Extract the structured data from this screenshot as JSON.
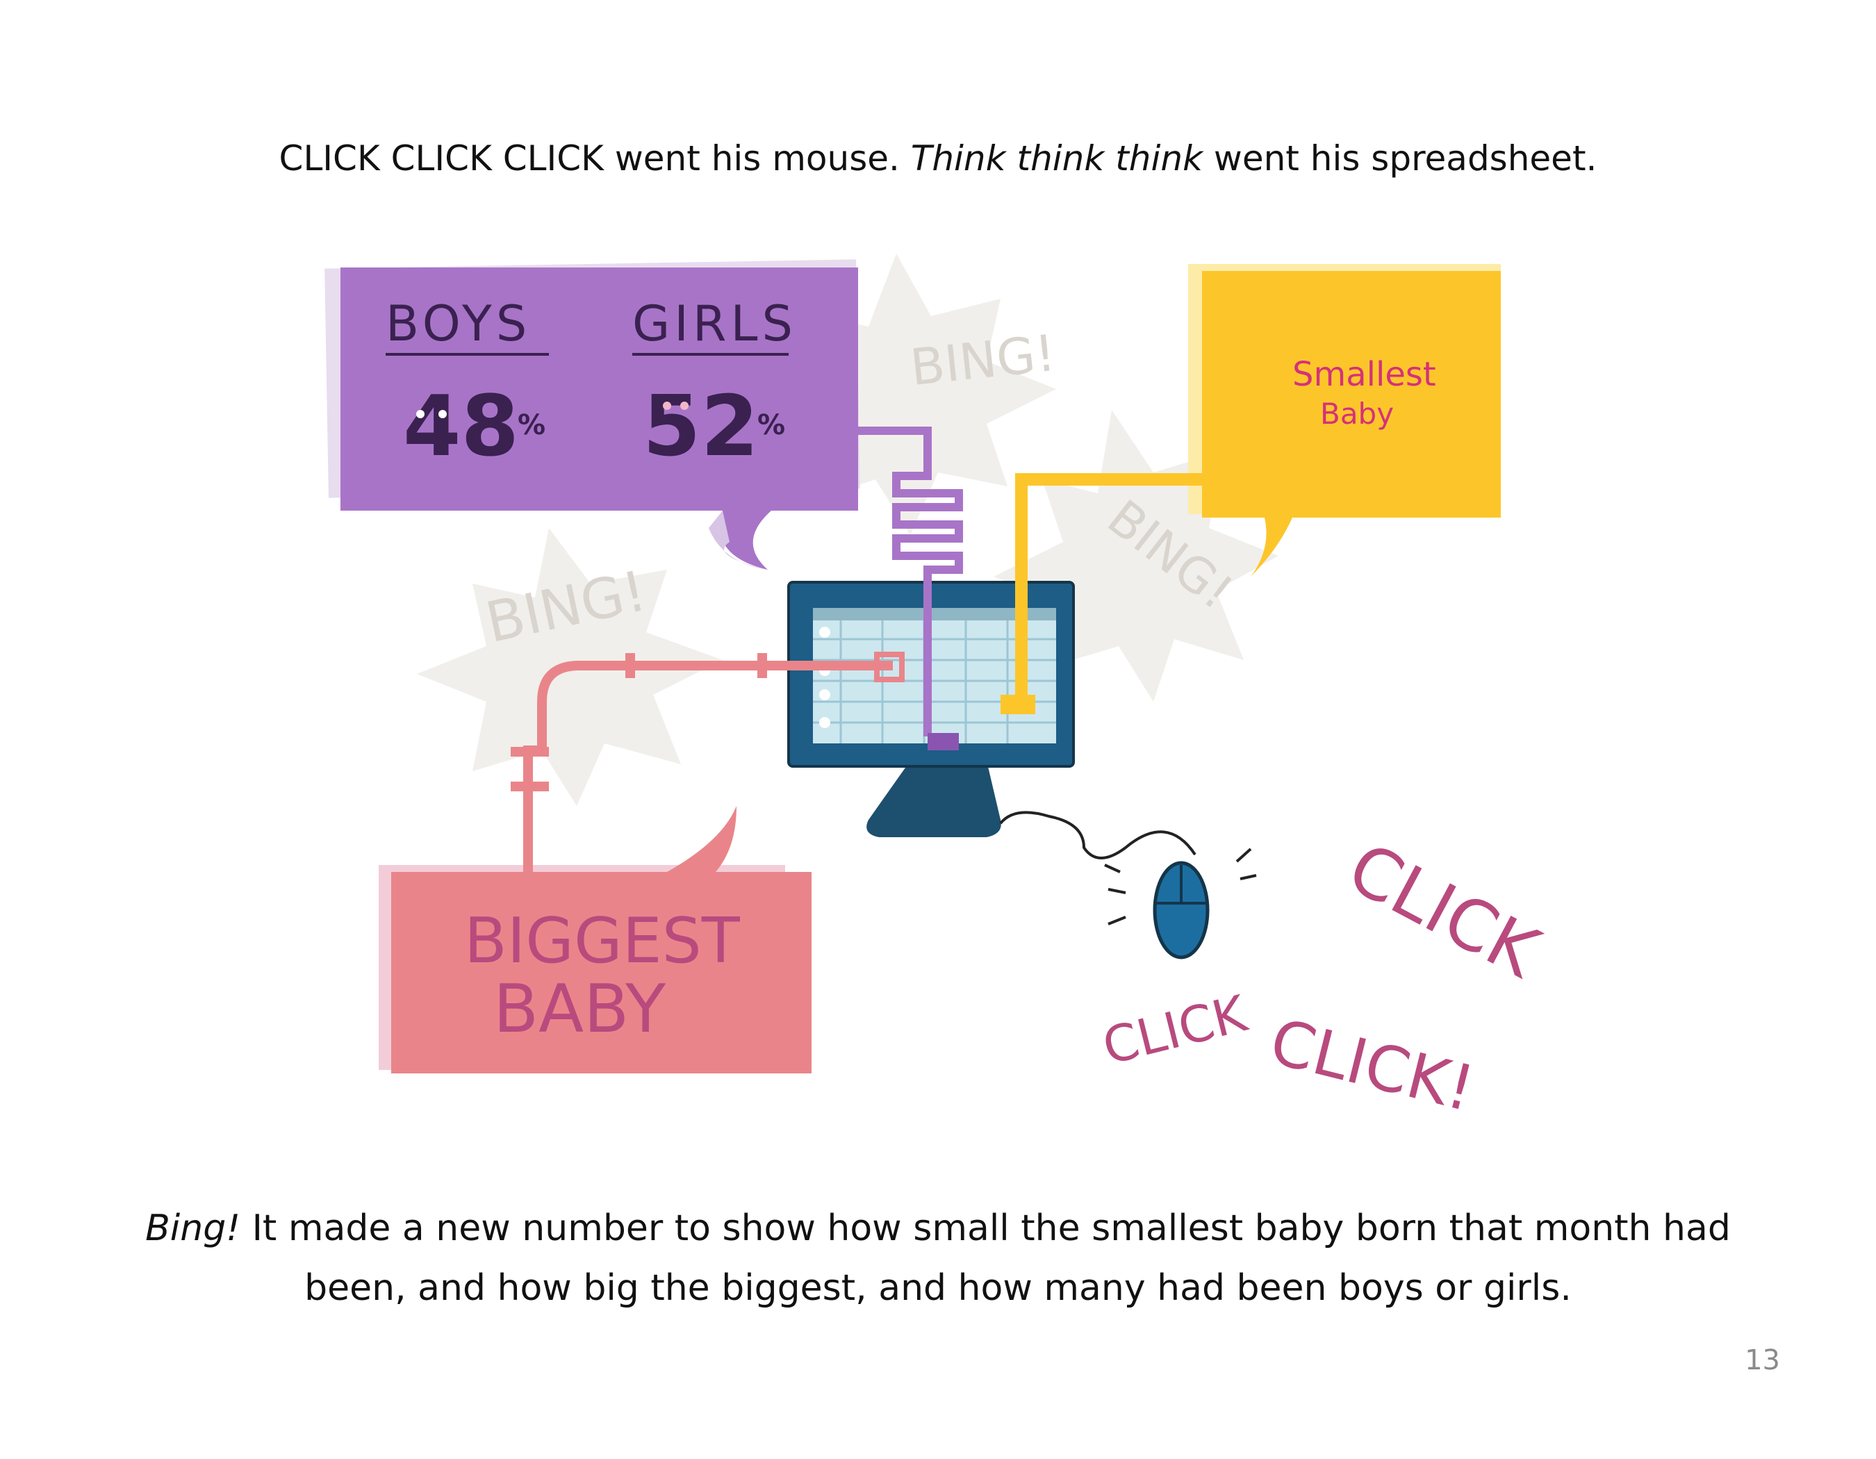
{
  "caption_top": {
    "part1": "CLICK CLICK CLICK went his mouse. ",
    "italic": "Think think think",
    "part2": " went his spreadsheet."
  },
  "illustration": {
    "boys_label": "BOYS",
    "girls_label": "GIRLS",
    "boys_percent": "48",
    "girls_percent": "52",
    "percent_sign": "%",
    "smallest_line1": "Smallest",
    "smallest_line2": "Baby",
    "biggest_line1": "BIGGEST",
    "biggest_line2": "BABY",
    "bing": "BING!",
    "click": "CLICK",
    "click_excl": "CLICK!"
  },
  "caption_bottom": {
    "italic": "Bing!",
    "text": " It made a new number to show how small the smallest baby born that month had been, and how big the biggest, and how many had been boys or girls."
  },
  "page_number": "13",
  "colors": {
    "purple": "#a874c8",
    "yellow": "#fcc62a",
    "pink_box": "#e9858a",
    "monitor": "#1d5d86",
    "magenta_text": "#b84a7e"
  }
}
